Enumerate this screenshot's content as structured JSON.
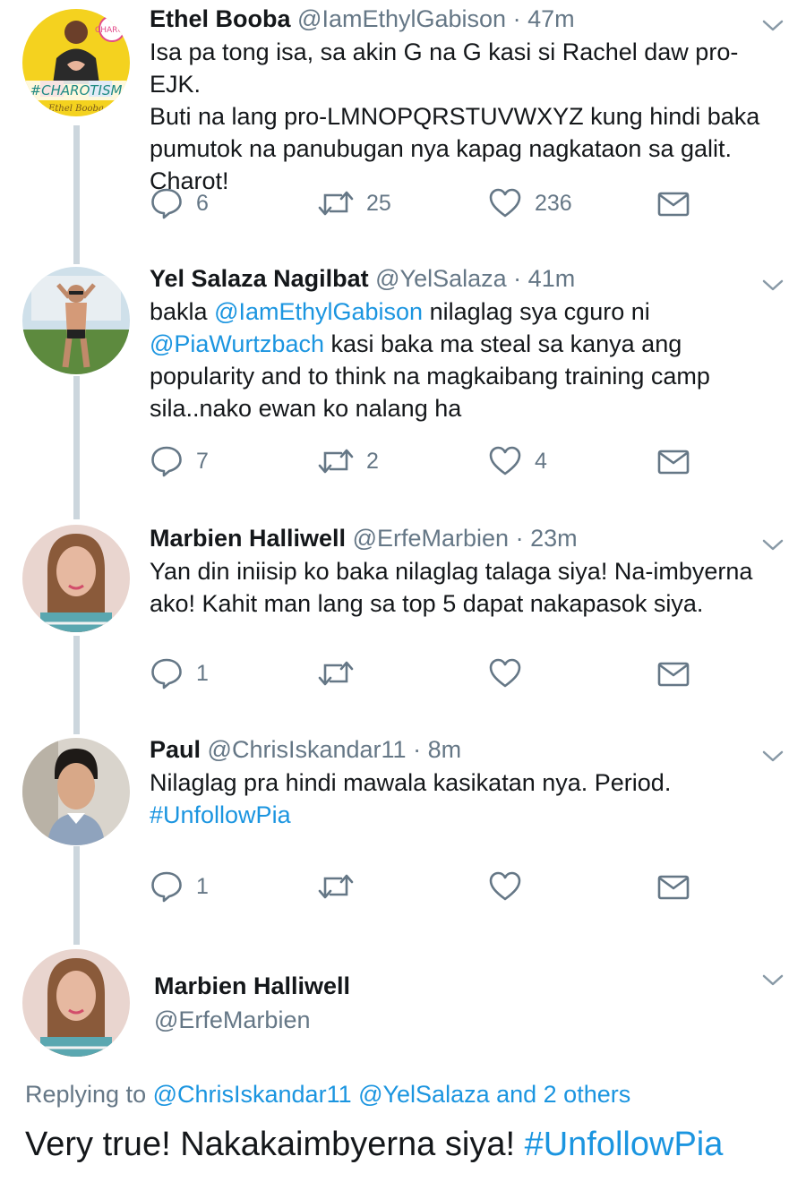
{
  "colors": {
    "link": "#1b95e0",
    "muted": "#657786",
    "text": "#14171a",
    "thread_line": "#ccd6dd"
  },
  "tweets": [
    {
      "name": "Ethel Booba",
      "handle": "@IamEthylGabison",
      "sep": "·",
      "time": "47m",
      "lines": [
        "Isa pa tong isa, sa akin G na G kasi si Rachel daw pro-EJK.",
        "Buti na lang pro-LMNOPQRSTUVWXYZ kung hindi baka",
        "pumutok na panubugan nya kapag nagkataon sa galit.",
        "Charot!"
      ],
      "replies": "6",
      "retweets": "25",
      "likes": "236",
      "avatar": {
        "badge": "#CHAROTISM",
        "sticker": "CHAROT",
        "signature": "Ethel Booba"
      }
    },
    {
      "name": "Yel Salaza Nagilbat",
      "handle": "@YelSalaza",
      "sep": "·",
      "time": "41m",
      "l1a": "bakla ",
      "l1link": "@IamEthylGabison",
      "l1b": " nilaglag sya cguro ni",
      "l2link": "@PiaWurtzbach",
      "l2b": " kasi baka ma steal sa kanya ang",
      "l3": "popularity and to think na magkaibang training camp",
      "l4": "sila..nako ewan ko nalang ha",
      "replies": "7",
      "retweets": "2",
      "likes": "4"
    },
    {
      "name": "Marbien Halliwell",
      "handle": "@ErfeMarbien",
      "sep": "·",
      "time": "23m",
      "lines": [
        "Yan din iniisip ko baka nilaglag talaga siya! Na-imbyerna",
        "ako! Kahit man lang sa top 5 dapat nakapasok siya."
      ],
      "replies": "1",
      "retweets": "",
      "likes": ""
    },
    {
      "name": "Paul",
      "handle": "@ChrisIskandar11",
      "sep": "·",
      "time": "8m",
      "l1": "Nilaglag pra hindi mawala kasikatan nya. Period.",
      "l2link": "#UnfollowPia",
      "replies": "1",
      "retweets": "",
      "likes": ""
    }
  ],
  "reply": {
    "name": "Marbien Halliwell",
    "handle": "@ErfeMarbien",
    "replying_label": "Replying to ",
    "replying_to": "@ChrisIskandar11 @YelSalaza and 2 others",
    "text": "Very true! Nakakaimbyerna siya! ",
    "hashtag": "#UnfollowPia"
  },
  "icons": {
    "reply": "reply-bubble-icon",
    "retweet": "retweet-arrows-icon",
    "like": "heart-icon",
    "dm": "envelope-icon",
    "more": "chevron-down-icon"
  }
}
